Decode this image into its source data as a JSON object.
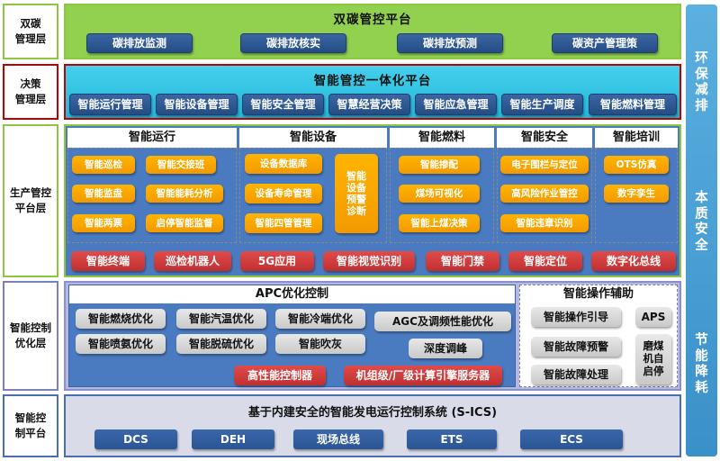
{
  "layers": {
    "l1": {
      "label": "双碳\n管理层",
      "title": "双碳管控平台",
      "items": [
        "碳排放监测",
        "碳排放核实",
        "碳排放预测",
        "碳资产管理策"
      ]
    },
    "l2": {
      "label": "决策\n管理层",
      "title": "智能管控一体化平台",
      "items": [
        "智能运行管理",
        "智能设备管理",
        "智能安全管理",
        "智慧经营决策",
        "智能应急管理",
        "智能生产调度",
        "智能燃料管理"
      ]
    },
    "l3": {
      "label": "生产管控\n平台层",
      "cols": {
        "ops": {
          "title": "智能运行",
          "items": [
            "智能巡检",
            "智能交接班",
            "智能监盘",
            "智能能耗分析",
            "智能两票",
            "启停智能监督"
          ]
        },
        "equip": {
          "title": "智能设备",
          "items": [
            "设备数据库",
            "设备寿命管理",
            "智能四管管理"
          ],
          "side": "智能\n设备\n预警\n诊断"
        },
        "fuel": {
          "title": "智能燃料",
          "items": [
            "智能掺配",
            "煤场可视化",
            "智能上煤决策"
          ]
        },
        "safety": {
          "title": "智能安全",
          "items": [
            "电子围栏与定位",
            "高风险作业管控",
            "智能违章识别"
          ]
        },
        "train": {
          "title": "智能培训",
          "items": [
            "OTS仿真",
            "数字孪生"
          ]
        }
      },
      "bottom": [
        "智能终端",
        "巡检机器人",
        "5G应用",
        "智能视觉识别",
        "智能门禁",
        "智能定位",
        "数字化总线"
      ]
    },
    "l4": {
      "label": "智能控制\n优化层",
      "apc_title": "APC优化控制",
      "apc_items": [
        "智能燃烧优化",
        "智能汽温优化",
        "智能冷端优化",
        "AGC及调频性能优化",
        "智能喷氨优化",
        "智能脱硫优化",
        "智能吹灰",
        "深度调峰"
      ],
      "apc_red": [
        "高性能控制器",
        "机组级/厂级计算引擎服务器"
      ],
      "assist_title": "智能操作辅助",
      "assist_items": [
        "智能操作引导",
        "APS",
        "智能故障预警",
        "磨煤\n机自\n启停",
        "智能故障处理"
      ]
    },
    "l5": {
      "label": "智能控\n制平台",
      "title": "基于内建安全的智能发电运行控制系统 (S-ICS)",
      "items": [
        "DCS",
        "DEH",
        "现场总线",
        "ETS",
        "ECS"
      ]
    }
  },
  "side": [
    "环\n保\n减\n排",
    "本\n质\n安\n全",
    "节\n能\n降\n耗"
  ],
  "colors": {
    "green": "#92d050",
    "cyan": "#33c7e6",
    "purple": "#b4b8e3",
    "band3": "#4a7bc0",
    "band5": "#d9dce8"
  }
}
